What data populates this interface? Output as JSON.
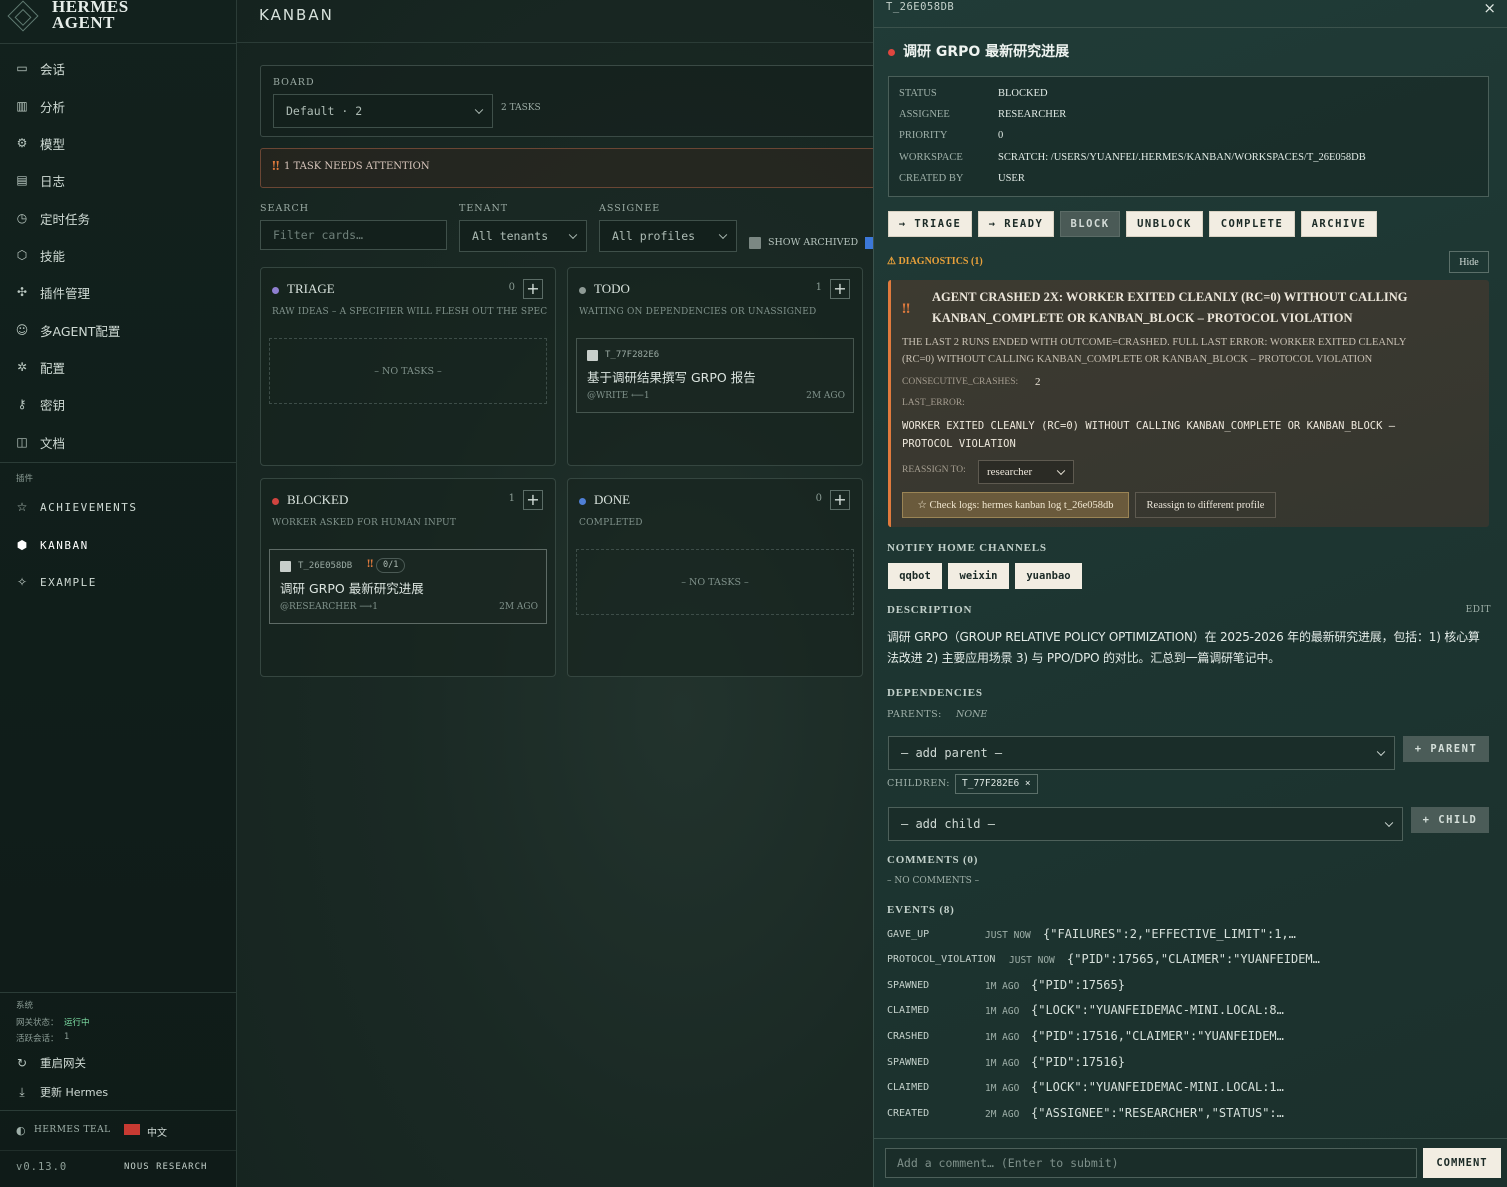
{
  "brand": {
    "line1": "HERMES",
    "line2": "AGENT"
  },
  "nav": [
    {
      "label": "会话",
      "icon": "chat-icon"
    },
    {
      "label": "分析",
      "icon": "chart-icon"
    },
    {
      "label": "模型",
      "icon": "cpu-icon"
    },
    {
      "label": "日志",
      "icon": "file-icon"
    },
    {
      "label": "定时任务",
      "icon": "clock-icon"
    },
    {
      "label": "技能",
      "icon": "cube-icon"
    },
    {
      "label": "插件管理",
      "icon": "puzzle-icon"
    },
    {
      "label": "多AGENT配置",
      "icon": "users-icon"
    },
    {
      "label": "配置",
      "icon": "settings-icon"
    },
    {
      "label": "密钥",
      "icon": "key-icon"
    },
    {
      "label": "文档",
      "icon": "book-icon"
    }
  ],
  "plugins": {
    "heading": "插件",
    "items": [
      {
        "label": "ACHIEVEMENTS",
        "icon": "star-icon"
      },
      {
        "label": "KANBAN",
        "icon": "cube-icon"
      },
      {
        "label": "EXAMPLE",
        "icon": "sparkle-icon"
      }
    ]
  },
  "system": {
    "heading": "系统",
    "gateway_label": "网关状态：",
    "gateway_value": "运行中",
    "sessions_label": "活跃会话：",
    "sessions_value": "1",
    "restart": "重启网关",
    "update": "更新 Hermes"
  },
  "footer": {
    "theme": "HERMES TEAL",
    "lang": "中文",
    "version": "v0.13.0",
    "org": "NOUS RESEARCH"
  },
  "main": {
    "title": "KANBAN",
    "board_label": "BOARD",
    "board_value": "Default · 2",
    "task_count": "2 TASKS",
    "attention": "1 TASK NEEDS ATTENTION",
    "search_label": "SEARCH",
    "search_placeholder": "Filter cards…",
    "tenant_label": "TENANT",
    "tenant_value": "All tenants",
    "assignee_label": "ASSIGNEE",
    "assignee_value": "All profiles",
    "show_archived": "SHOW ARCHIVED",
    "columns": [
      {
        "name": "TRIAGE",
        "count": "0",
        "desc": "RAW IDEAS – A SPECIFIER WILL FLESH OUT THE SPEC",
        "empty": "– NO TASKS –",
        "color": "#8f7fd0"
      },
      {
        "name": "TODO",
        "count": "1",
        "desc": "WAITING ON DEPENDENCIES OR UNASSIGNED",
        "color": "#8e9a95",
        "card": {
          "id": "T_77F282E6",
          "title": "基于调研结果撰写 GRPO 报告",
          "meta": "@WRITE  ⟵1",
          "ago": "2M AGO"
        }
      },
      {
        "name": "BLOCKED",
        "count": "1",
        "desc": "WORKER ASKED FOR HUMAN INPUT",
        "color": "#d0443f",
        "card": {
          "id": "T_26E058DB",
          "badge": "0/1",
          "title": "调研 GRPO 最新研究进展",
          "meta": "@RESEARCHER  ⟶1",
          "ago": "2M AGO"
        }
      },
      {
        "name": "DONE",
        "count": "0",
        "desc": "COMPLETED",
        "empty": "– NO TASKS –",
        "color": "#4f7fd6"
      }
    ]
  },
  "drawer": {
    "id": "T_26E058DB",
    "title": "调研 GRPO 最新研究进展",
    "fields": [
      {
        "k": "STATUS",
        "v": "BLOCKED"
      },
      {
        "k": "ASSIGNEE",
        "v": "RESEARCHER"
      },
      {
        "k": "PRIORITY",
        "v": "0"
      },
      {
        "k": "WORKSPACE",
        "v": "SCRATCH: /USERS/YUANFEI/.HERMES/KANBAN/WORKSPACES/T_26E058DB"
      },
      {
        "k": "CREATED BY",
        "v": "USER"
      }
    ],
    "actions": [
      "→ TRIAGE",
      "→ READY",
      "BLOCK",
      "UNBLOCK",
      "COMPLETE",
      "ARCHIVE"
    ],
    "diagnostics": {
      "heading": "⚠ DIAGNOSTICS (1)",
      "hide": "Hide",
      "title1": "AGENT CRASHED 2X: WORKER EXITED CLEANLY (RC=0) WITHOUT CALLING",
      "title2": "KANBAN_COMPLETE OR KANBAN_BLOCK – PROTOCOL VIOLATION",
      "body1": "THE LAST 2 RUNS ENDED WITH OUTCOME=CRASHED. FULL LAST ERROR: WORKER EXITED CLEANLY",
      "body2": "(RC=0) WITHOUT CALLING KANBAN_COMPLETE OR KANBAN_BLOCK – PROTOCOL VIOLATION",
      "crashes_label": "CONSECUTIVE_CRASHES:",
      "crashes_value": "2",
      "last_error_label": "LAST_ERROR:",
      "err1": "WORKER EXITED CLEANLY (RC=0) WITHOUT CALLING KANBAN_COMPLETE OR KANBAN_BLOCK –",
      "err2": "PROTOCOL VIOLATION",
      "reassign_label": "REASSIGN TO:",
      "reassign_value": "researcher",
      "check_logs": "☆ Check logs: hermes kanban log t_26e058db",
      "reassign_btn": "Reassign to different profile"
    },
    "notify": {
      "heading": "NOTIFY HOME CHANNELS",
      "channels": [
        "qqbot",
        "weixin",
        "yuanbao"
      ]
    },
    "description": {
      "heading": "DESCRIPTION",
      "edit": "EDIT",
      "line1": "调研 GRPO（GROUP RELATIVE POLICY OPTIMIZATION）在 2025-2026 年的最新研究进展，包括：1) 核心算",
      "line2": "法改进 2) 主要应用场景 3) 与 PPO/DPO 的对比。汇总到一篇调研笔记中。"
    },
    "deps": {
      "heading": "DEPENDENCIES",
      "parents_label": "PARENTS:",
      "parents_value": "NONE",
      "add_parent": "– add parent –",
      "parent_btn": "+ PARENT",
      "children_label": "CHILDREN:",
      "child_chip": "T_77F282E6 ×",
      "add_child": "– add child –",
      "child_btn": "+ CHILD"
    },
    "comments": {
      "heading": "COMMENTS (0)",
      "empty": "– NO COMMENTS –",
      "placeholder": "Add a comment… (Enter to submit)",
      "button": "COMMENT"
    },
    "events": {
      "heading": "EVENTS (8)",
      "items": [
        {
          "k": "GAVE_UP",
          "t": "JUST NOW",
          "p": "{\"FAILURES\":2,\"EFFECTIVE_LIMIT\":1,…"
        },
        {
          "k": "PROTOCOL_VIOLATION",
          "t": "JUST NOW",
          "p": "{\"PID\":17565,\"CLAIMER\":\"YUANFEIDEM…"
        },
        {
          "k": "SPAWNED",
          "t": "1M AGO",
          "p": "{\"PID\":17565}"
        },
        {
          "k": "CLAIMED",
          "t": "1M AGO",
          "p": "{\"LOCK\":\"YUANFEIDEMAC-MINI.LOCAL:8…"
        },
        {
          "k": "CRASHED",
          "t": "1M AGO",
          "p": "{\"PID\":17516,\"CLAIMER\":\"YUANFEIDEM…"
        },
        {
          "k": "SPAWNED",
          "t": "1M AGO",
          "p": "{\"PID\":17516}"
        },
        {
          "k": "CLAIMED",
          "t": "1M AGO",
          "p": "{\"LOCK\":\"YUANFEIDEMAC-MINI.LOCAL:1…"
        },
        {
          "k": "CREATED",
          "t": "2M AGO",
          "p": "{\"ASSIGNEE\":\"RESEARCHER\",\"STATUS\":…"
        }
      ]
    }
  }
}
